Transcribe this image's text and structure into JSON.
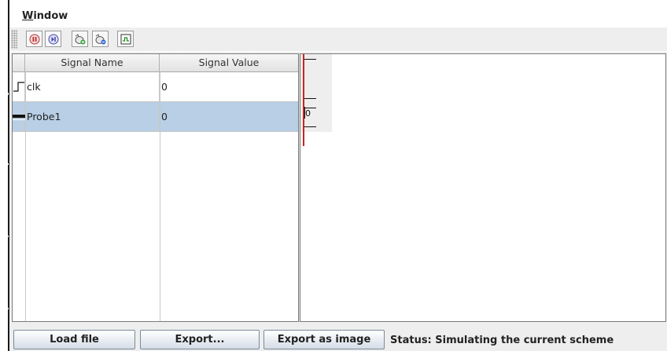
{
  "menubar": {
    "window_menu": "Window"
  },
  "toolbar": {
    "buttons": [
      {
        "icon": "pause-icon"
      },
      {
        "icon": "step-icon"
      },
      {
        "icon": "add-probe-icon"
      },
      {
        "icon": "remove-probe-icon"
      },
      {
        "icon": "waveform-icon"
      }
    ]
  },
  "table": {
    "headers": {
      "name": "Signal Name",
      "value": "Signal Value"
    },
    "rows": [
      {
        "icon": "clock-signal-icon",
        "name": "clk",
        "value": "0",
        "selected": false
      },
      {
        "icon": "bus-signal-icon",
        "name": "Probe1",
        "value": "0",
        "selected": true
      }
    ]
  },
  "waveform": {
    "probe1_value": "0",
    "cursor_color": "#cc2222"
  },
  "bottom": {
    "load_label": "Load file",
    "export_label": "Export...",
    "export_image_label": "Export as image",
    "status": "Status: Simulating the current scheme"
  },
  "colors": {
    "selection": "#b8cfe5",
    "panel_bg": "#eeeeee"
  }
}
